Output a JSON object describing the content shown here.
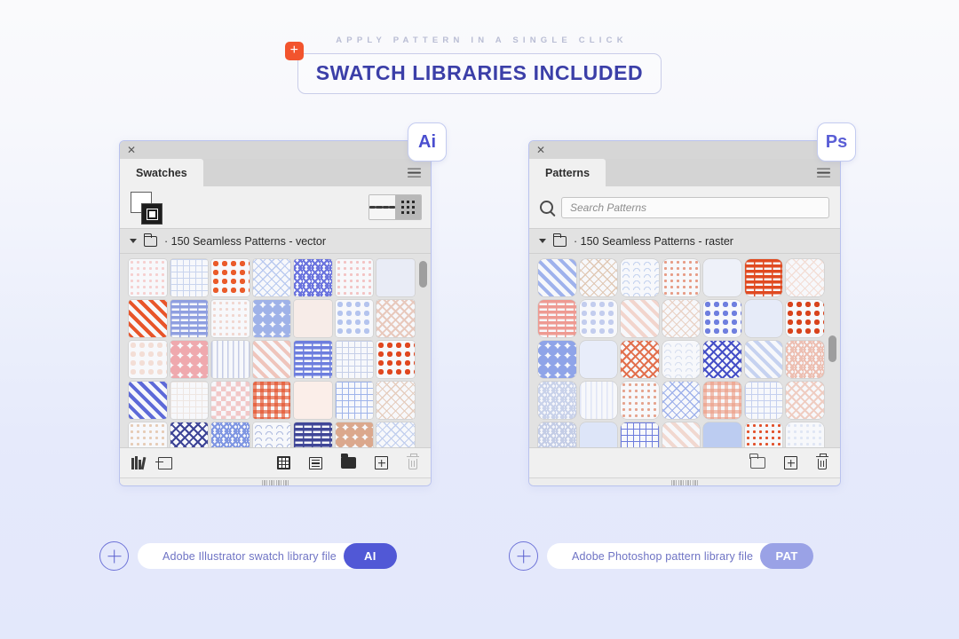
{
  "header": {
    "eyebrow": "APPLY PATTERN IN A SINGLE CLICK",
    "title": "SWATCH LIBRARIES INCLUDED",
    "plus_badge_icon": "plus-icon",
    "plus_badge_color": "#f2542d",
    "title_color": "#3b3fa8"
  },
  "panels": {
    "illustrator": {
      "app_badge": "Ai",
      "close_icon": "close-icon",
      "tab_label": "Swatches",
      "menu_icon": "panel-menu-icon",
      "fill_stroke_icon": "fill-stroke-icon",
      "view_list_icon": "list-view-icon",
      "view_grid_icon": "grid-view-icon",
      "view_selected": "grid",
      "folder_row_label": "· 150 Seamless Patterns - vector",
      "folder_icon": "folder-icon",
      "disclosure_icon": "chevron-down-icon",
      "scroll_thumb_top_pct": 2,
      "footer_icons": [
        "swatch-libraries-icon",
        "show-swatch-kinds-icon",
        "swatch-options-icon",
        "list-options-icon",
        "new-color-group-icon",
        "new-swatch-icon",
        "delete-swatch-icon"
      ],
      "trash_enabled": false
    },
    "photoshop": {
      "app_badge": "Ps",
      "close_icon": "close-icon",
      "tab_label": "Patterns",
      "menu_icon": "panel-menu-icon",
      "search_icon": "search-icon",
      "search_value": "",
      "search_placeholder": "Search Patterns",
      "folder_row_label": "· 150 Seamless Patterns - raster",
      "folder_icon": "folder-icon",
      "disclosure_icon": "chevron-down-icon",
      "scroll_thumb_top_pct": 42,
      "footer_icons": [
        "new-group-icon",
        "new-pattern-icon",
        "delete-pattern-icon"
      ],
      "trash_enabled": true
    }
  },
  "files": [
    {
      "plus_icon": "circle-plus-icon",
      "label": "Adobe Illustrator swatch library file",
      "extension": "AI",
      "extension_color": "#5158d6"
    },
    {
      "plus_icon": "circle-plus-icon",
      "label": "Adobe Photoshop pattern library file",
      "extension": "PAT",
      "extension_color": "#9aa2e6"
    }
  ],
  "swatches": {
    "illustrator": [
      {
        "k": "dots",
        "c": "#f6cfcf"
      },
      {
        "k": "grid",
        "c": "#c9d4ee"
      },
      {
        "k": "circles",
        "c": "#ea5b2a"
      },
      {
        "k": "diaggrid",
        "c": "#b9c9ef"
      },
      {
        "k": "zigzag",
        "c": "#6a73de"
      },
      {
        "k": "dots",
        "c": "#f3c3c3"
      },
      {
        "k": "plain",
        "c": "#e9ecf6"
      },
      {
        "k": "diagstripe",
        "c": "#e8552a"
      },
      {
        "k": "brick",
        "c": "#8f9fe0"
      },
      {
        "k": "dots",
        "c": "#f0d6cf"
      },
      {
        "k": "scallop",
        "c": "#9fb2e8"
      },
      {
        "k": "plain",
        "c": "#f7ece8"
      },
      {
        "k": "circles",
        "c": "#b4c4ee"
      },
      {
        "k": "crosshatch",
        "c": "#e8c9bd"
      },
      {
        "k": "circles",
        "c": "#f3ded6"
      },
      {
        "k": "scallop",
        "c": "#efa9ae"
      },
      {
        "k": "stripe",
        "c": "#c4cbe6"
      },
      {
        "k": "diagstripe",
        "c": "#efc5bc"
      },
      {
        "k": "brick",
        "c": "#6d7ede"
      },
      {
        "k": "grid",
        "c": "#c6cfe8"
      },
      {
        "k": "circles",
        "c": "#e0471f"
      },
      {
        "k": "diagstripe",
        "c": "#5d6ad8"
      },
      {
        "k": "grid",
        "c": "#eee6e2"
      },
      {
        "k": "checker",
        "c": "#f2c8c8"
      },
      {
        "k": "gingham",
        "c": "#e24a22"
      },
      {
        "k": "plain",
        "c": "#fbeee9"
      },
      {
        "k": "grid",
        "c": "#9fb4ea"
      },
      {
        "k": "diaggrid",
        "c": "#e5cdbe"
      },
      {
        "k": "dots",
        "c": "#e6cbb5"
      },
      {
        "k": "crosshatch",
        "c": "#3c4396"
      },
      {
        "k": "zigzag",
        "c": "#7f96e2"
      },
      {
        "k": "wave",
        "c": "#b7c2e2"
      },
      {
        "k": "brick",
        "c": "#3f4697"
      },
      {
        "k": "scallop",
        "c": "#dba88d"
      },
      {
        "k": "diaggrid",
        "c": "#c2cfee"
      }
    ],
    "photoshop": [
      {
        "k": "diagstripe",
        "c": "#9fb2ec"
      },
      {
        "k": "diaggrid",
        "c": "#e0c8b4"
      },
      {
        "k": "wave",
        "c": "#c9d6f0"
      },
      {
        "k": "dots",
        "c": "#e79c86"
      },
      {
        "k": "plain",
        "c": "#eef1f9"
      },
      {
        "k": "brick",
        "c": "#e04a20"
      },
      {
        "k": "diaggrid",
        "c": "#f3ded6"
      },
      {
        "k": "brick",
        "c": "#ee9a92"
      },
      {
        "k": "circles",
        "c": "#c3cdee"
      },
      {
        "k": "diagstripe",
        "c": "#f2d5cd"
      },
      {
        "k": "diaggrid",
        "c": "#e9d2c6"
      },
      {
        "k": "circles",
        "c": "#6f7fdf"
      },
      {
        "k": "plain",
        "c": "#e6ebf8"
      },
      {
        "k": "circles",
        "c": "#d8431c"
      },
      {
        "k": "scallop",
        "c": "#8fa4e8"
      },
      {
        "k": "plain",
        "c": "#e8edfa"
      },
      {
        "k": "crosshatch",
        "c": "#e2714f"
      },
      {
        "k": "wave",
        "c": "#dbe2f1"
      },
      {
        "k": "crosshatch",
        "c": "#4650c7"
      },
      {
        "k": "diagstripe",
        "c": "#c6d2f0"
      },
      {
        "k": "zigzag",
        "c": "#edbfb2"
      },
      {
        "k": "zigzag",
        "c": "#c9d2ea"
      },
      {
        "k": "stripe",
        "c": "#dfe5f6"
      },
      {
        "k": "dots",
        "c": "#e5a28c"
      },
      {
        "k": "diaggrid",
        "c": "#9db0ea"
      },
      {
        "k": "gingham",
        "c": "#eb9b83"
      },
      {
        "k": "grid",
        "c": "#c5d0ef"
      },
      {
        "k": "crosshatch",
        "c": "#efcdc2"
      },
      {
        "k": "zigzag",
        "c": "#c4cde6"
      },
      {
        "k": "plain",
        "c": "#dde5f8"
      },
      {
        "k": "grid",
        "c": "#6d7cdd"
      },
      {
        "k": "diagstripe",
        "c": "#f1d8d0"
      },
      {
        "k": "plain",
        "c": "#bcccf1"
      },
      {
        "k": "dots",
        "c": "#e2502a"
      },
      {
        "k": "dots",
        "c": "#dfe6f4"
      }
    ]
  }
}
